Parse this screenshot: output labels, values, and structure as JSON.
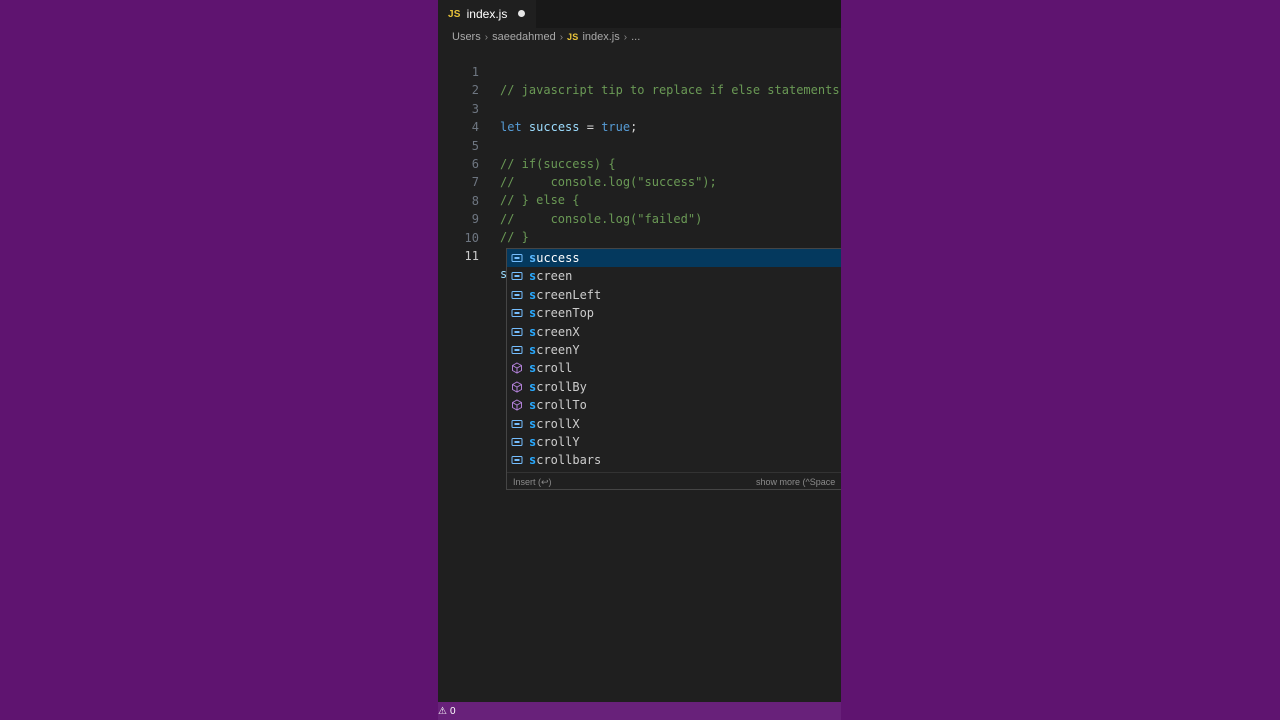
{
  "tab": {
    "badge": "JS",
    "label": "index.js"
  },
  "breadcrumb": {
    "items": [
      "Users",
      "saeedahmed"
    ],
    "file_badge": "JS",
    "file": "index.js",
    "trail": "..."
  },
  "code": {
    "lines": [
      {
        "num": "1",
        "text": "// javascript tip to replace if else statements"
      },
      {
        "num": "2",
        "text": ""
      },
      {
        "num": "3",
        "kw": "let",
        "var": "success",
        "op": " = ",
        "val": "true",
        "end": ";"
      },
      {
        "num": "4",
        "text": ""
      },
      {
        "num": "5",
        "text": "// if(success) {"
      },
      {
        "num": "6",
        "text": "//     console.log(\"success\");"
      },
      {
        "num": "7",
        "text": "// } else {"
      },
      {
        "num": "8",
        "text": "//     console.log(\"failed\")"
      },
      {
        "num": "9",
        "text": "// }"
      },
      {
        "num": "10",
        "text": ""
      },
      {
        "num": "11",
        "typed": "s"
      }
    ]
  },
  "suggest": {
    "items": [
      {
        "match": "s",
        "rest": "uccess",
        "kind": "variable"
      },
      {
        "match": "s",
        "rest": "creen",
        "kind": "variable"
      },
      {
        "match": "s",
        "rest": "creenLeft",
        "kind": "variable"
      },
      {
        "match": "s",
        "rest": "creenTop",
        "kind": "variable"
      },
      {
        "match": "s",
        "rest": "creenX",
        "kind": "variable"
      },
      {
        "match": "s",
        "rest": "creenY",
        "kind": "variable"
      },
      {
        "match": "s",
        "rest": "croll",
        "kind": "method"
      },
      {
        "match": "s",
        "rest": "crollBy",
        "kind": "method"
      },
      {
        "match": "s",
        "rest": "crollTo",
        "kind": "method"
      },
      {
        "match": "s",
        "rest": "crollX",
        "kind": "variable"
      },
      {
        "match": "s",
        "rest": "crollY",
        "kind": "variable"
      },
      {
        "match": "s",
        "rest": "crollbars",
        "kind": "variable"
      }
    ],
    "footer_insert": "Insert (↩)",
    "footer_more": "show more (^Space"
  },
  "status": {
    "warnings": "0"
  },
  "colors": {
    "background": "#5f1470",
    "editor": "#1f1f1f",
    "selected": "#04395e",
    "statusbar": "#68217a"
  }
}
